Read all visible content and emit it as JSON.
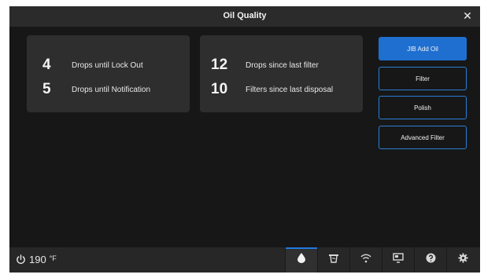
{
  "header": {
    "title": "Oil Quality"
  },
  "stats_left": [
    {
      "value": "4",
      "label": "Drops until Lock Out"
    },
    {
      "value": "5",
      "label": "Drops until Notification"
    }
  ],
  "stats_right": [
    {
      "value": "12",
      "label": "Drops since last filter"
    },
    {
      "value": "10",
      "label": "Filters since last disposal"
    }
  ],
  "actions": {
    "jib_add_oil": "JIB Add Oil",
    "filter": "Filter",
    "polish": "Polish",
    "advanced_filter": "Advanced Filter"
  },
  "footer": {
    "temperature": "190",
    "temperature_unit": "°F",
    "icons": [
      "oil-drop-icon",
      "fryer-icon",
      "wifi-icon",
      "screen-icon",
      "help-icon",
      "settings-icon"
    ],
    "active_icon": "oil-drop-icon"
  },
  "colors": {
    "accent": "#1f6fd1",
    "background": "#171717",
    "card": "#2e2e2e"
  }
}
